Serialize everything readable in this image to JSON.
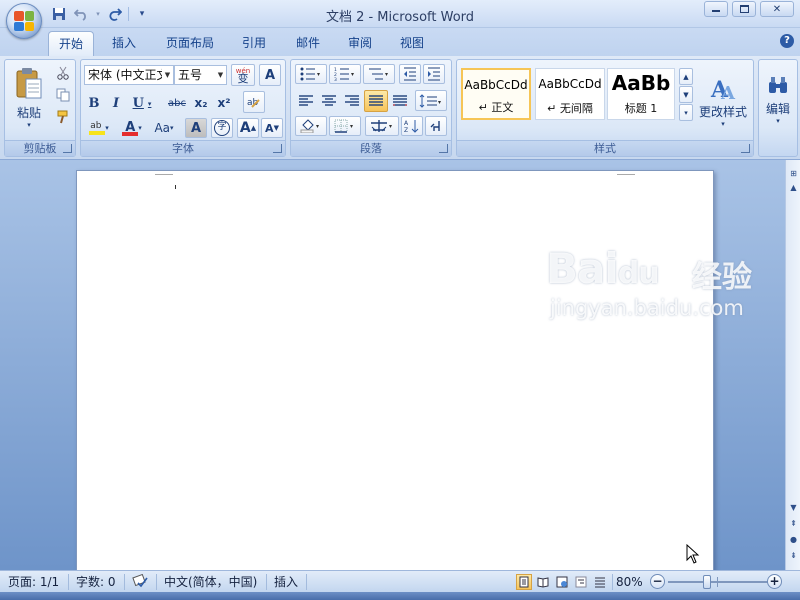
{
  "window": {
    "title": "文档 2 - Microsoft Word",
    "controls": {
      "minimize": "▭",
      "restore": "▣",
      "close": "✕"
    }
  },
  "qat": {
    "icons": [
      "save-icon",
      "undo-icon",
      "redo-icon",
      "customize-icon"
    ]
  },
  "tabs": [
    {
      "label": "开始",
      "active": true
    },
    {
      "label": "插入"
    },
    {
      "label": "页面布局"
    },
    {
      "label": "引用"
    },
    {
      "label": "邮件"
    },
    {
      "label": "审阅"
    },
    {
      "label": "视图"
    }
  ],
  "help_label": "?",
  "ribbon": {
    "clipboard": {
      "group_label": "剪贴板",
      "paste_label": "粘贴"
    },
    "font": {
      "group_label": "字体",
      "font_name": "宋体 (中文正文",
      "font_size": "五号",
      "bold": "B",
      "italic": "I",
      "underline": "U",
      "strike": "abc",
      "subscript": "x₂",
      "superscript": "x²",
      "color_a": "A",
      "case": "Aa",
      "char_border": "A",
      "enclose": "字",
      "grow": "A",
      "shrink": "A",
      "phonetic": "wén",
      "phonetic_char": "变"
    },
    "paragraph": {
      "group_label": "段落"
    },
    "styles": {
      "group_label": "样式",
      "items": [
        {
          "sample": "AaBbCcDd",
          "name": "↵ 正文",
          "selected": true
        },
        {
          "sample": "AaBbCcDd",
          "name": "↵ 无间隔",
          "selected": false
        },
        {
          "sample": "AaBb",
          "name": "标题 1",
          "selected": false
        }
      ],
      "change_styles_label": "更改样式"
    },
    "editing": {
      "label": "编辑"
    }
  },
  "statusbar": {
    "page": "页面: 1/1",
    "words": "字数: 0",
    "language": "中文(简体，中国)",
    "mode": "插入",
    "zoom": "80%",
    "zoom_minus": "−",
    "zoom_plus": "+",
    "zoom_level_percent": 80
  },
  "watermark": {
    "brand": "Bai",
    "brand2": "du",
    "cn": "经验",
    "url": "jingyan.baidu.com"
  },
  "colors": {
    "accent": "#15428b",
    "ribbon_bg": "#dfe9f7",
    "doc_bg": "#6e94c9",
    "highlight": "#f6c45b"
  }
}
